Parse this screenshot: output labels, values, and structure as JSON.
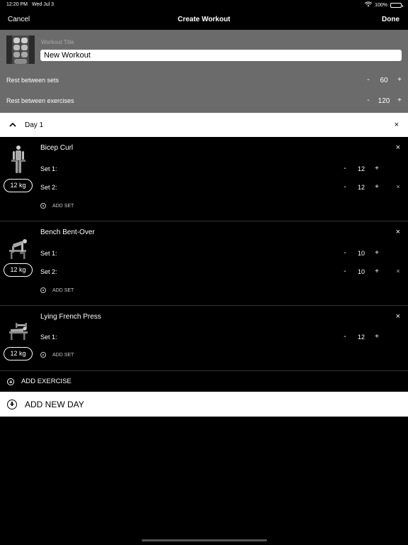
{
  "status_bar": {
    "time": "12:20 PM",
    "date": "Wed Jul 3",
    "battery": "100%",
    "battery_level": 1.0,
    "icons": [
      "wifi-icon",
      "battery-icon"
    ]
  },
  "nav": {
    "cancel_label": "Cancel",
    "title": "Create Workout",
    "done_label": "Done"
  },
  "workout": {
    "title_label": "Workout Title",
    "title_value": "New Workout",
    "image_icon": "abs-muscle-image",
    "rest_sets": {
      "label": "Rest between sets",
      "minus": "-",
      "value": "60",
      "plus": "+"
    },
    "rest_exercises": {
      "label": "Rest between exercises",
      "minus": "-",
      "value": "120",
      "plus": "+"
    }
  },
  "day": {
    "title": "Day 1",
    "close": "×",
    "chevron_icon": "chevron-up-icon"
  },
  "exercises": [
    {
      "name": "Bicep Curl",
      "weight": "12 kg",
      "close": "×",
      "image_icon": "bicep-curl-figure",
      "sets": [
        {
          "label": "Set 1:",
          "minus": "-",
          "value": "12",
          "plus": "+"
        },
        {
          "label": "Set 2:",
          "minus": "-",
          "value": "12",
          "plus": "+",
          "remove": "×"
        }
      ],
      "add_set": "ADD SET"
    },
    {
      "name": "Bench Bent-Over",
      "weight": "12 kg",
      "close": "×",
      "image_icon": "bench-bent-over-figure",
      "sets": [
        {
          "label": "Set 1:",
          "minus": "-",
          "value": "10",
          "plus": "+"
        },
        {
          "label": "Set 2:",
          "minus": "-",
          "value": "10",
          "plus": "+",
          "remove": "×"
        }
      ],
      "add_set": "ADD SET"
    },
    {
      "name": "Lying French Press",
      "weight": "12 kg",
      "close": "×",
      "image_icon": "lying-french-press-figure",
      "sets": [
        {
          "label": "Set 1:",
          "minus": "-",
          "value": "12",
          "plus": "+"
        }
      ],
      "add_set": "ADD SET"
    }
  ],
  "add_exercise_label": "ADD EXERCISE",
  "add_day_label": "ADD NEW DAY",
  "colors": {
    "settings_bg": "#6b6b6b",
    "background": "#000000",
    "panel_white": "#ffffff"
  }
}
